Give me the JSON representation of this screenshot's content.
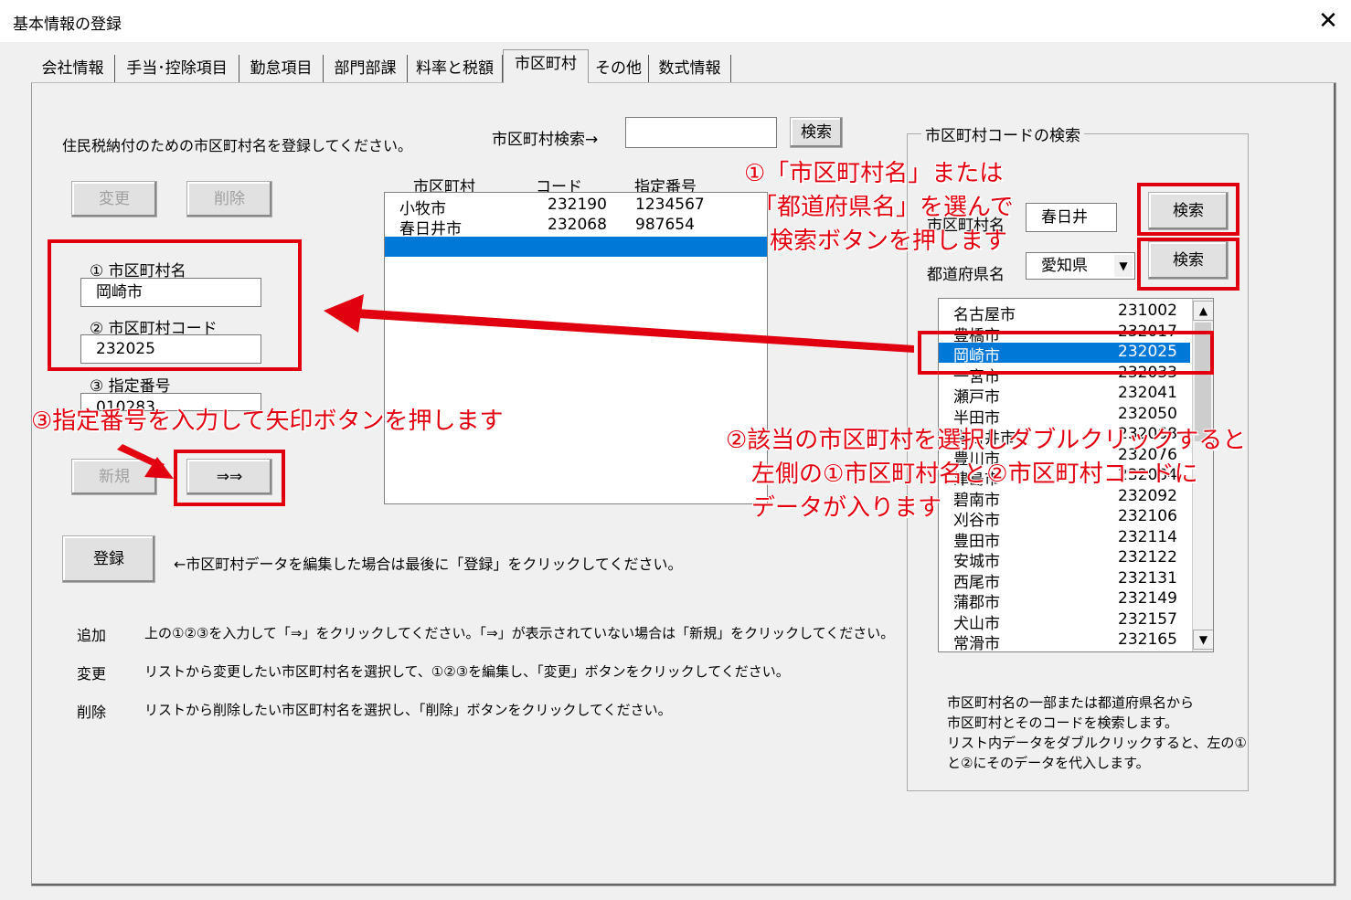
{
  "window": {
    "title": "基本情報の登録",
    "close_icon": "close-icon"
  },
  "tabs": [
    {
      "label": "会社情報"
    },
    {
      "label": "手当･控除項目"
    },
    {
      "label": "勤怠項目"
    },
    {
      "label": "部門部課"
    },
    {
      "label": "料率と税額"
    },
    {
      "label": "市区町村",
      "active": true
    },
    {
      "label": "その他"
    },
    {
      "label": "数式情報"
    }
  ],
  "main": {
    "instruction": "住民税納付のための市区町村名を登録してください。",
    "search_label": "市区町村検索→",
    "search_value": "",
    "search_button": "検索",
    "change_button": "変更",
    "delete_button": "削除",
    "new_button": "新規",
    "arrow_button": "⇒⇒",
    "register_button": "登録",
    "register_note": "←市区町村データを編集した場合は最後に「登録」をクリックしてください。",
    "fields": {
      "city_name_label": "① 市区町村名",
      "city_name_value": "岡崎市",
      "city_code_label": "② 市区町村コード",
      "city_code_value": "232025",
      "designation_label": "③ 指定番号",
      "designation_value": "010283"
    },
    "list_headers": [
      "市区町村",
      "コード",
      "指定番号"
    ],
    "list_rows": [
      {
        "city": "小牧市",
        "code": "232190",
        "num": "1234567"
      },
      {
        "city": "春日井市",
        "code": "232068",
        "num": "987654"
      }
    ],
    "help": [
      {
        "key": "追加",
        "text": "上の①②③を入力して「⇒」をクリックしてください。「⇒」が表示されていない場合は「新規」をクリックしてください。"
      },
      {
        "key": "変更",
        "text": "リストから変更したい市区町村名を選択して、①②③を編集し、「変更」ボタンをクリックしてください。"
      },
      {
        "key": "削除",
        "text": "リストから削除したい市区町村名を選択し、「削除」ボタンをクリックしてください。"
      }
    ]
  },
  "code_search": {
    "group_title": "市区町村コードの検索",
    "city_label": "市区町村名",
    "city_value": "春日井",
    "pref_label": "都道府県名",
    "pref_value": "愛知県",
    "search_button": "検索",
    "rows": [
      {
        "city": "名古屋市",
        "code": "231002"
      },
      {
        "city": "豊橋市",
        "code": "232017"
      },
      {
        "city": "岡崎市",
        "code": "232025",
        "selected": true
      },
      {
        "city": "一宮市",
        "code": "232033"
      },
      {
        "city": "瀬戸市",
        "code": "232041"
      },
      {
        "city": "半田市",
        "code": "232050"
      },
      {
        "city": "春日井市",
        "code": "232068"
      },
      {
        "city": "豊川市",
        "code": "232076"
      },
      {
        "city": "津島市",
        "code": "232084"
      },
      {
        "city": "碧南市",
        "code": "232092"
      },
      {
        "city": "刈谷市",
        "code": "232106"
      },
      {
        "city": "豊田市",
        "code": "232114"
      },
      {
        "city": "安城市",
        "code": "232122"
      },
      {
        "city": "西尾市",
        "code": "232131"
      },
      {
        "city": "蒲郡市",
        "code": "232149"
      },
      {
        "city": "犬山市",
        "code": "232157"
      },
      {
        "city": "常滑市",
        "code": "232165"
      }
    ],
    "note_lines": [
      "市区町村名の一部または都道府県名から",
      "市区町村とそのコードを検索します。",
      "リスト内データをダブルクリックすると、左の①",
      "と②にそのデータを代入します。"
    ]
  },
  "annotations": {
    "a1_lines": [
      "①「市区町村名」または",
      "「都道府県名」を選んで",
      "検索ボタンを押します"
    ],
    "a2_lines": [
      "②該当の市区町村を選択しダブルクリックすると",
      "左側の①市区町村名と②市区町村コードに",
      "データが入ります"
    ],
    "a3": "③指定番号を入力して矢印ボタンを押します",
    "color": "#e00010"
  }
}
